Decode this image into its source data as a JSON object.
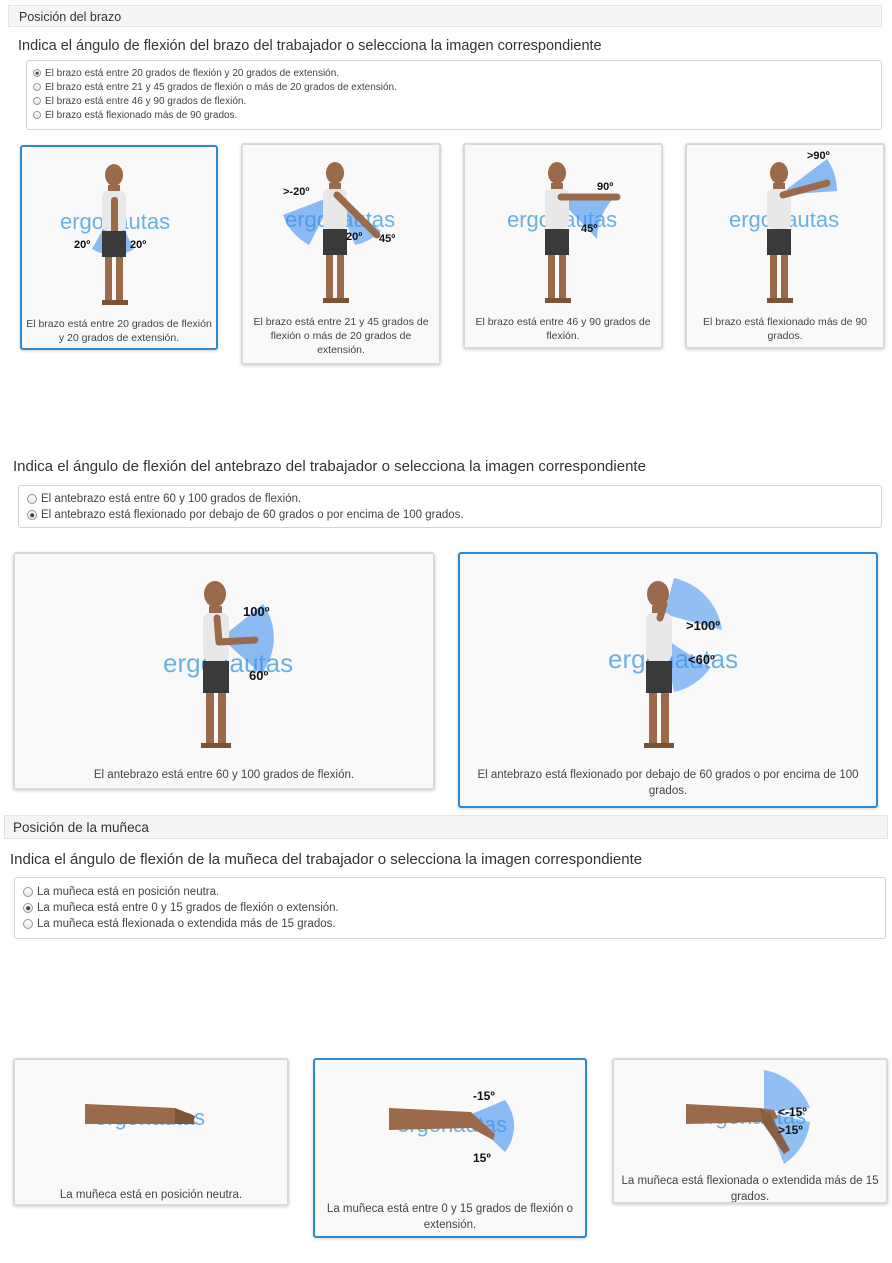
{
  "arm": {
    "section_title": "Posición del brazo",
    "prompt": "Indica el ángulo de flexión del brazo del trabajador o selecciona la imagen correspondiente",
    "options": [
      {
        "label": "El brazo está entre 20 grados de flexión y 20 grados de extensión.",
        "checked": true
      },
      {
        "label": "El brazo está entre 21 y 45 grados de flexión o más de 20 grados de extensión.",
        "checked": false
      },
      {
        "label": "El brazo está entre 46 y 90 grados de flexión.",
        "checked": false
      },
      {
        "label": "El brazo está flexionado más de 90 grados.",
        "checked": false
      }
    ],
    "cards": [
      {
        "caption": "El brazo está entre 20 grados de flexión y 20 grados de extensión.",
        "selected": true,
        "angles": [
          "20º",
          "20º"
        ]
      },
      {
        "caption": "El brazo está entre 21 y 45 grados de flexión o más de 20 grados de extensión.",
        "selected": false,
        "angles": [
          ">-20º",
          "20º",
          "45º"
        ]
      },
      {
        "caption": "El brazo está entre 46 y 90 grados de flexión.",
        "selected": false,
        "angles": [
          "90º",
          "45º"
        ]
      },
      {
        "caption": "El brazo está flexionado más de 90 grados.",
        "selected": false,
        "angles": [
          ">90º"
        ]
      }
    ]
  },
  "forearm": {
    "prompt": "Indica el ángulo de flexión del antebrazo del trabajador o selecciona la imagen correspondiente",
    "options": [
      {
        "label": "El antebrazo está entre 60 y 100 grados de flexión.",
        "checked": false
      },
      {
        "label": "El antebrazo está flexionado por debajo de 60 grados o por encima de 100 grados.",
        "checked": true
      }
    ],
    "cards": [
      {
        "caption": "El antebrazo está entre 60 y 100 grados de flexión.",
        "selected": false,
        "angles": [
          "100º",
          "60º"
        ]
      },
      {
        "caption": "El antebrazo está flexionado por debajo de 60 grados o por encima de 100 grados.",
        "selected": true,
        "angles": [
          ">100º",
          "<60º"
        ]
      }
    ]
  },
  "wrist": {
    "section_title": "Posición de la muñeca",
    "prompt": "Indica el ángulo de flexión de la muñeca del trabajador o selecciona la imagen correspondiente",
    "options": [
      {
        "label": "La muñeca está en posición neutra.",
        "checked": false
      },
      {
        "label": "La muñeca está entre 0 y 15 grados de flexión o extensión.",
        "checked": true
      },
      {
        "label": "La muñeca está flexionada o extendida más de 15 grados.",
        "checked": false
      }
    ],
    "cards": [
      {
        "caption": "La muñeca está en posición neutra.",
        "selected": false,
        "angles": []
      },
      {
        "caption": "La muñeca está entre 0 y 15 grados de flexión o extensión.",
        "selected": true,
        "angles": [
          "-15º",
          "15º"
        ]
      },
      {
        "caption": "La muñeca está flexionada o extendida más de 15 grados.",
        "selected": false,
        "angles": [
          "<-15º",
          ">15º"
        ]
      }
    ]
  },
  "watermark": "ergonautas",
  "colors": {
    "selected_border": "#2b8ad8",
    "angle_fill": "#3d8ff0",
    "skin": "#9a6a4a",
    "shirt": "#e8e8e8",
    "shorts": "#3a3a3a"
  }
}
